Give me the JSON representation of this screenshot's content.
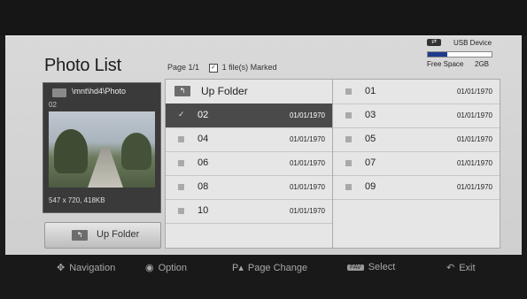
{
  "header": {
    "title": "Photo List",
    "page_label": "Page",
    "page_value": "1/1",
    "marked": "1 file(s) Marked"
  },
  "device": {
    "icon": "usb-icon",
    "label": "USB Device",
    "free_space_label": "Free Space",
    "free_space_value": "2GB",
    "usage_fraction": 0.3
  },
  "preview": {
    "path": "\\mnt\\hd4\\Photo",
    "file_name": "02",
    "resolution": "547 x 720, 418KB"
  },
  "up_folder_button": {
    "label": "Up Folder"
  },
  "file_list": {
    "up_folder_label": "Up Folder",
    "left_column": [
      {
        "name": "02",
        "date": "01/01/1970",
        "selected": true,
        "marked": true
      },
      {
        "name": "04",
        "date": "01/01/1970"
      },
      {
        "name": "06",
        "date": "01/01/1970"
      },
      {
        "name": "08",
        "date": "01/01/1970"
      },
      {
        "name": "10",
        "date": "01/01/1970"
      }
    ],
    "right_column": [
      {
        "name": "01",
        "date": "01/01/1970"
      },
      {
        "name": "03",
        "date": "01/01/1970"
      },
      {
        "name": "05",
        "date": "01/01/1970"
      },
      {
        "name": "07",
        "date": "01/01/1970"
      },
      {
        "name": "09",
        "date": "01/01/1970"
      }
    ]
  },
  "bottom_nav": {
    "navigation": "Navigation",
    "option": "Option",
    "page_change": "Page Change",
    "fav_badge": "FAV",
    "select": "Select",
    "exit": "Exit"
  }
}
